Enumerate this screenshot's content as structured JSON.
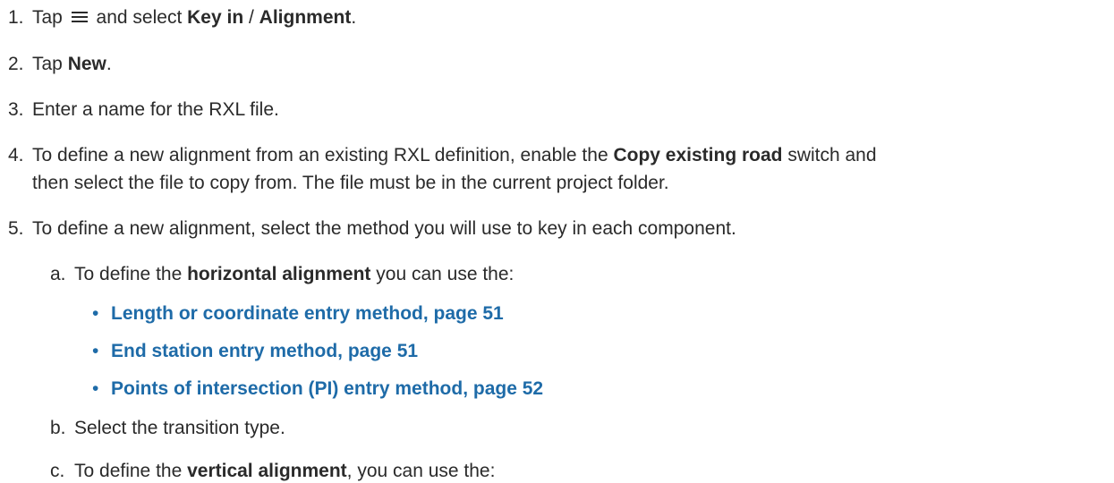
{
  "steps": [
    {
      "num": "1.",
      "pre": "Tap",
      "mid": "and select",
      "b1": "Key in",
      "sep": " / ",
      "b2": "Alignment",
      "post": "."
    },
    {
      "num": "2.",
      "pre": "Tap ",
      "b1": "New",
      "post": "."
    },
    {
      "num": "3.",
      "text": "Enter a name for the RXL file."
    },
    {
      "num": "4.",
      "pre": "To define a new alignment from an existing RXL definition, enable the ",
      "b1": "Copy existing road",
      "post": " switch and",
      "line2": "then select the file to copy from. The file must be in the current project folder."
    },
    {
      "num": "5.",
      "text": "To define a new alignment, select the method you will use to key in each component."
    }
  ],
  "substeps": [
    {
      "num": "a.",
      "pre": "To define the ",
      "b1": "horizontal alignment",
      "post": " you can use the:"
    },
    {
      "num": "b.",
      "text": "Select the transition type."
    },
    {
      "num": "c.",
      "pre": "To define the ",
      "b1": "vertical alignment",
      "post": ", you can use the:"
    }
  ],
  "links": [
    "Length or coordinate entry method, page 51",
    "End station entry method, page 51",
    "Points of intersection (PI) entry method, page 52"
  ],
  "icon": "menu-icon",
  "colors": {
    "text": "#2a2a2a",
    "link": "#1e6ba8"
  }
}
